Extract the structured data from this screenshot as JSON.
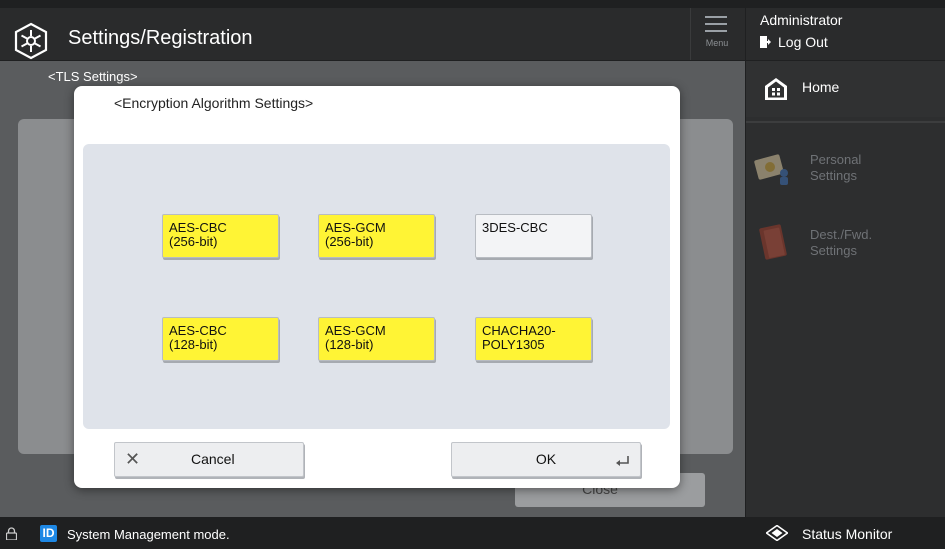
{
  "header": {
    "title": "Settings/Registration",
    "menu_label": "Menu"
  },
  "user": {
    "name": "Administrator",
    "logout_label": "Log Out"
  },
  "sidebar": {
    "home_label": "Home",
    "personal_label": "Personal\nSettings",
    "dest_label": "Dest./Fwd.\nSettings"
  },
  "background": {
    "section_title": "<TLS Settings>",
    "close_label": "Close"
  },
  "dialog": {
    "title": "<Encryption Algorithm Settings>",
    "algorithms": [
      {
        "label": "AES-CBC\n(256-bit)",
        "selected": true
      },
      {
        "label": "AES-GCM\n(256-bit)",
        "selected": true
      },
      {
        "label": "3DES-CBC",
        "selected": false
      },
      {
        "label": "AES-CBC\n(128-bit)",
        "selected": true
      },
      {
        "label": "AES-GCM\n(128-bit)",
        "selected": true
      },
      {
        "label": "CHACHA20-\nPOLY1305",
        "selected": true
      }
    ],
    "cancel_label": "Cancel",
    "ok_label": "OK"
  },
  "status": {
    "id_badge": "ID",
    "mode_text": "System Management mode.",
    "monitor_label": "Status Monitor"
  },
  "colors": {
    "selected": "#fff435",
    "unselected": "#f3f4f6",
    "id_badge": "#1e88e5"
  }
}
